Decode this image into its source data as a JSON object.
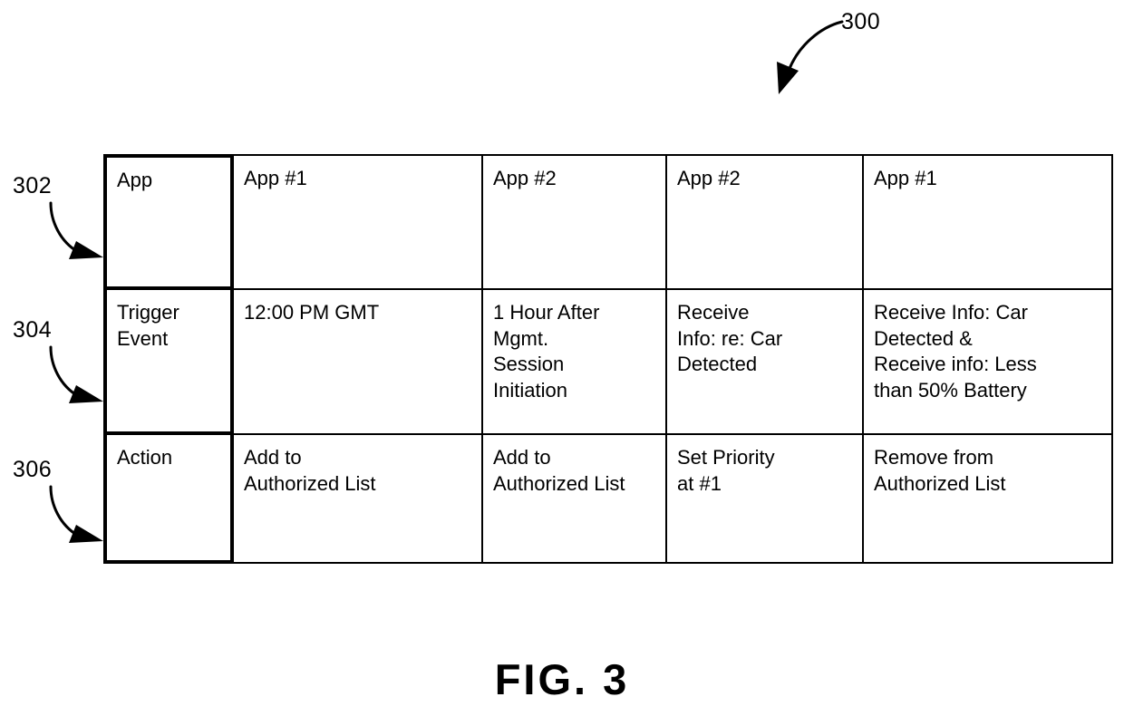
{
  "figure": {
    "caption": "FIG. 3",
    "reference_numeral": "300"
  },
  "row_refs": {
    "app": "302",
    "trigger_event": "304",
    "action": "306"
  },
  "table": {
    "row_headers": [
      "App",
      "Trigger Event",
      "Action"
    ],
    "columns": [
      {
        "app": "App #1",
        "trigger_event": "12:00 PM GMT",
        "action": "Add to\nAuthorized List"
      },
      {
        "app": "App #2",
        "trigger_event": "1 Hour After\nMgmt.\nSession\nInitiation",
        "action": "Add to\nAuthorized List"
      },
      {
        "app": "App #2",
        "trigger_event": "Receive\nInfo: re: Car\nDetected",
        "action": "Set Priority\nat #1"
      },
      {
        "app": "App #1",
        "trigger_event": "Receive Info: Car\nDetected &\nReceive info: Less\nthan 50% Battery",
        "action": "Remove from\nAuthorized List"
      }
    ]
  },
  "colors": {
    "line": "#000000",
    "background": "#ffffff"
  }
}
